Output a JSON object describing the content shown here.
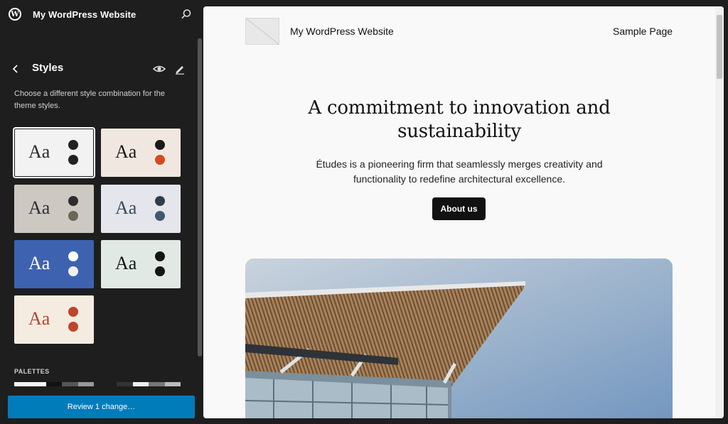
{
  "topbar": {
    "site_title": "My WordPress Website",
    "logo_icon": "wordpress-logo-icon",
    "search_icon": "search-icon"
  },
  "styles_panel": {
    "title": "Styles",
    "back_icon": "chevron-left-icon",
    "preview_icon": "eye-icon",
    "edit_icon": "pencil-icon",
    "description": "Choose a different style combination for the theme styles.",
    "variations": [
      {
        "label": "Aa",
        "bg": "#f2f2f2",
        "text_color": "#2a2a2a",
        "dot1": "#222222",
        "dot2": "#222222",
        "active": true
      },
      {
        "label": "Aa",
        "bg": "#f0e8e0",
        "text_color": "#1a1a1a",
        "dot1": "#1a1a1a",
        "dot2": "#d64a20",
        "active": false
      },
      {
        "label": "Aa",
        "bg": "#cdc9c2",
        "text_color": "#2f2f2f",
        "dot1": "#2d2d2d",
        "dot2": "#6b655a",
        "active": false
      },
      {
        "label": "Aa",
        "bg": "#e4e6ec",
        "text_color": "#394b5c",
        "dot1": "#2e3d4c",
        "dot2": "#3f5a6c",
        "active": false
      },
      {
        "label": "Aa",
        "bg": "#3d62b0",
        "text_color": "#ffffff",
        "dot1": "#ffffff",
        "dot2": "#f0f0f0",
        "active": false
      },
      {
        "label": "Aa",
        "bg": "#e1e9e5",
        "text_color": "#151515",
        "dot1": "#151515",
        "dot2": "#151515",
        "active": false
      },
      {
        "label": "Aa",
        "bg": "#f4ece1",
        "text_color": "#b8452b",
        "dot1": "#c1432b",
        "dot2": "#c1432b",
        "active": false
      }
    ],
    "palettes_label": "PALETTES"
  },
  "footer": {
    "review_label": "Review 1 change…"
  },
  "preview": {
    "site_title": "My WordPress Website",
    "nav_link": "Sample Page",
    "heading": "A commitment to innovation and sustainability",
    "body": "Études is a pioneering firm that seamlessly merges creativity and functionality to redefine architectural excellence.",
    "button_label": "About us"
  },
  "colors": {
    "accent": "#007cba",
    "sidebar_bg": "#1e1e1e",
    "canvas_bg": "#f9f9f9"
  }
}
